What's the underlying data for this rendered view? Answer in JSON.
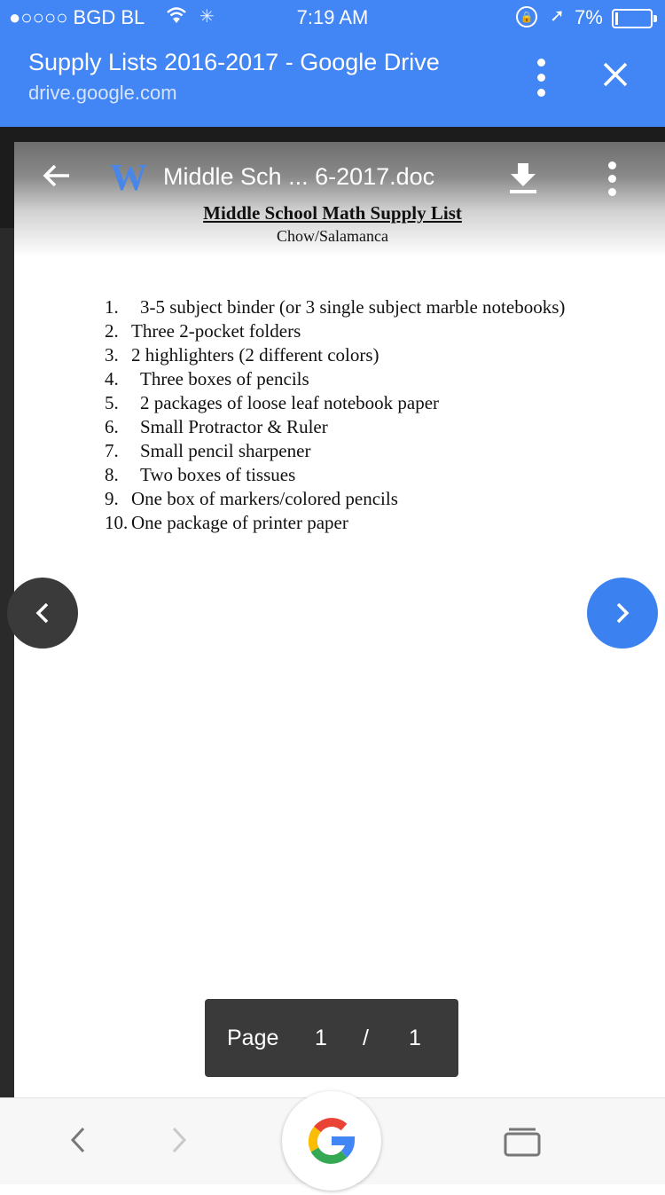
{
  "status_bar": {
    "carrier": "●○○○○ BGD BL",
    "time": "7:19 AM",
    "battery_percent": "7%",
    "battery_level": 0.07
  },
  "app_header": {
    "title": "Supply Lists 2016-2017 - Google Drive",
    "url": "drive.google.com"
  },
  "doc_toolbar": {
    "app_icon_letter": "W",
    "file_name": "Middle Sch ... 6-2017.doc"
  },
  "document": {
    "heading": "Middle School Math Supply List",
    "subheading": "Chow/Salamanca",
    "items": [
      {
        "num": "1.",
        "text": "3-5 subject binder (or 3 single subject marble notebooks)"
      },
      {
        "num": "2.",
        "text": "Three 2-pocket folders"
      },
      {
        "num": "3.",
        "text": "2 highlighters (2 different colors)"
      },
      {
        "num": "4.",
        "text": "Three boxes of pencils"
      },
      {
        "num": "5.",
        "text": "2 packages of loose leaf notebook paper"
      },
      {
        "num": "6.",
        "text": "Small Protractor & Ruler"
      },
      {
        "num": "7.",
        "text": "Small pencil sharpener"
      },
      {
        "num": "8.",
        "text": "Two boxes of tissues"
      },
      {
        "num": "9.",
        "text": "One box of markers/colored pencils"
      },
      {
        "num": "10.",
        "text": "One package of printer paper"
      }
    ]
  },
  "navigation": {
    "prev_glyph": "‹",
    "next_glyph": "›"
  },
  "page_indicator": {
    "label": "Page",
    "current": "1",
    "separator": "/",
    "total": "1"
  },
  "bottom_bar": {
    "back_glyph": "‹",
    "forward_glyph": "›"
  },
  "icons": {
    "wifi": "wifi-icon",
    "loading": "loading-spinner-icon",
    "rotation_lock": "rotation-lock-icon",
    "location": "location-arrow-icon",
    "download": "download-icon",
    "google": "google-g-icon",
    "tabs": "tabs-icon"
  },
  "colors": {
    "header_blue": "#4285f4",
    "next_button": "#3b82f0",
    "word_blue": "#4a86e8"
  }
}
